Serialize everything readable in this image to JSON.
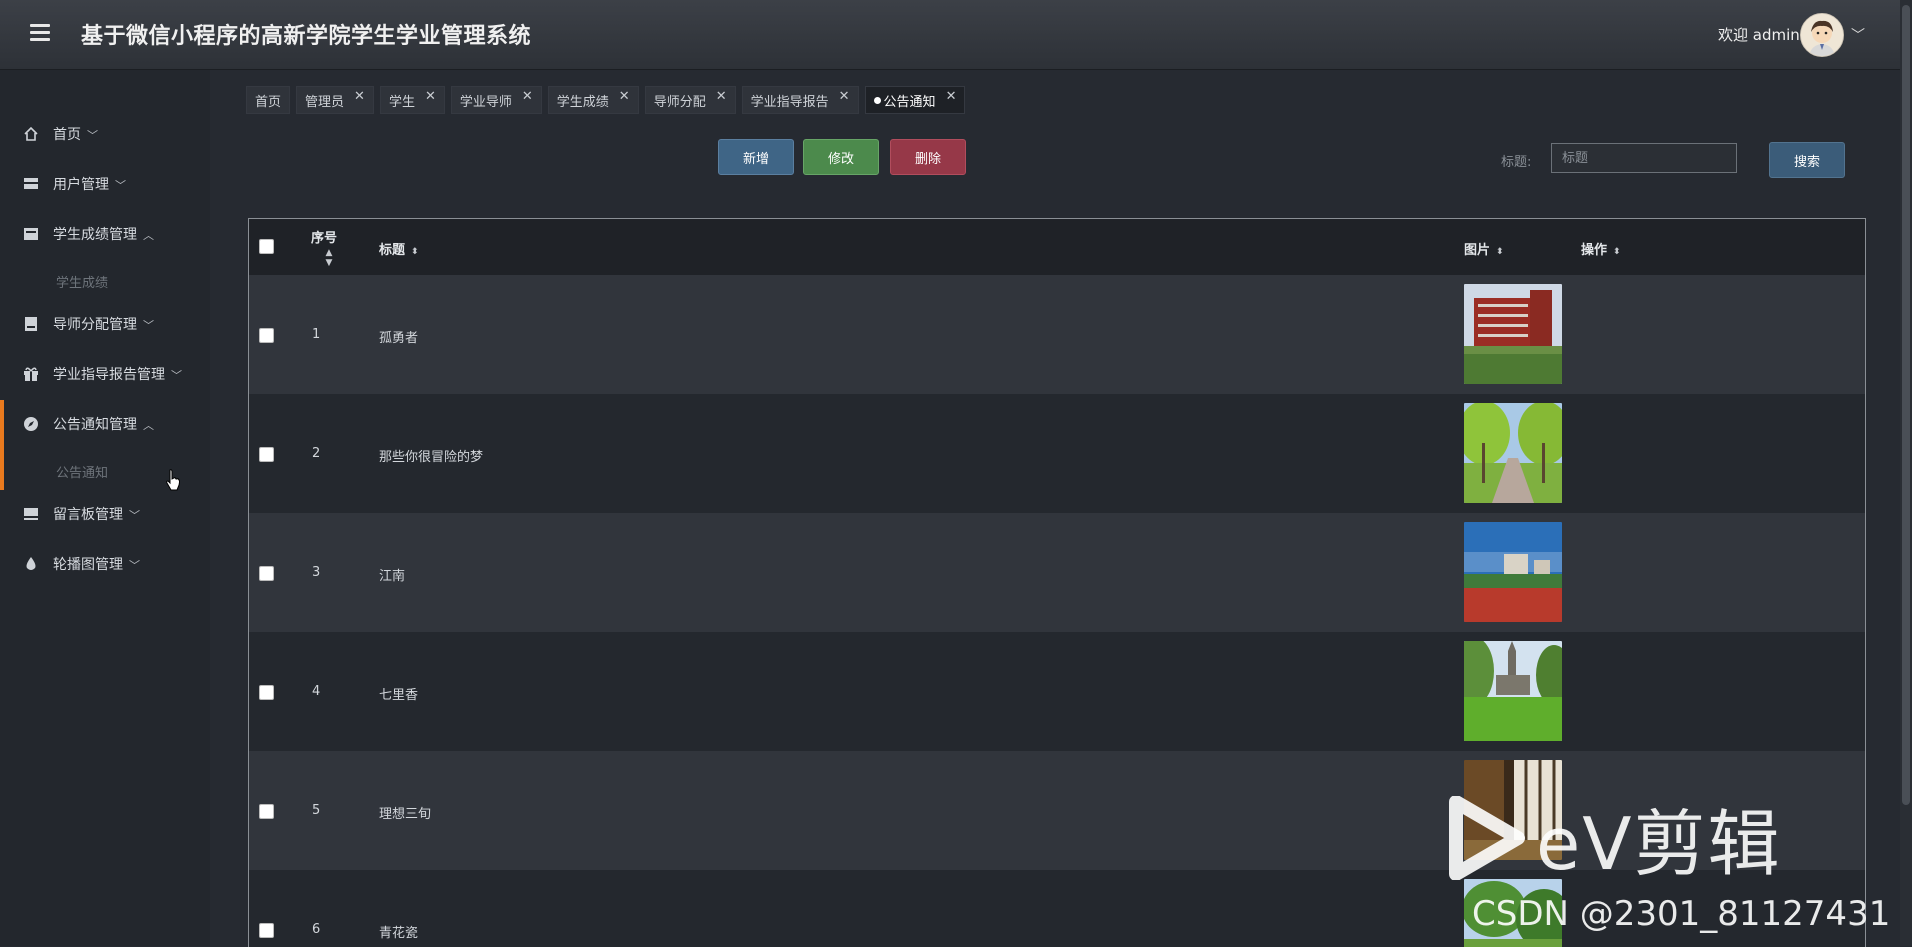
{
  "header": {
    "title": "基于微信小程序的高新学院学生学业管理系统",
    "welcome": "欢迎 admin"
  },
  "sidebar": {
    "items": [
      {
        "label": "首页",
        "icon": "home-icon",
        "chevron": "﹀"
      },
      {
        "label": "用户管理",
        "icon": "user-manage-icon",
        "chevron": "﹀"
      },
      {
        "label": "学生成绩管理",
        "icon": "grade-icon",
        "chevron": "︿",
        "sub": "学生成绩"
      },
      {
        "label": "导师分配管理",
        "icon": "tutor-icon",
        "chevron": "﹀"
      },
      {
        "label": "学业指导报告管理",
        "icon": "gift-icon",
        "chevron": "﹀"
      },
      {
        "label": "公告通知管理",
        "icon": "compass-icon",
        "chevron": "︿",
        "sub": "公告通知"
      },
      {
        "label": "留言板管理",
        "icon": "board-icon",
        "chevron": "﹀"
      },
      {
        "label": "轮播图管理",
        "icon": "drop-icon",
        "chevron": "﹀"
      }
    ]
  },
  "tabs": [
    {
      "label": "首页",
      "closable": false
    },
    {
      "label": "管理员",
      "closable": true
    },
    {
      "label": "学生",
      "closable": true
    },
    {
      "label": "学业导师",
      "closable": true
    },
    {
      "label": "学生成绩",
      "closable": true
    },
    {
      "label": "导师分配",
      "closable": true
    },
    {
      "label": "学业指导报告",
      "closable": true
    },
    {
      "label": "公告通知",
      "closable": true,
      "active": true
    }
  ],
  "toolbar": {
    "add_label": "新增",
    "edit_label": "修改",
    "delete_label": "删除",
    "search_label": "标题:",
    "search_placeholder": "标题",
    "search_button": "搜索"
  },
  "table": {
    "headers": {
      "index": "序号",
      "title": "标题",
      "image": "图片",
      "action": "操作"
    },
    "rows": [
      {
        "index": "1",
        "title": "孤勇者",
        "image": "building-photo"
      },
      {
        "index": "2",
        "title": "那些你很冒险的梦",
        "image": "tree-road-photo"
      },
      {
        "index": "3",
        "title": "江南",
        "image": "campus-track-photo"
      },
      {
        "index": "4",
        "title": "七里香",
        "image": "church-lawn-photo"
      },
      {
        "index": "5",
        "title": "理想三旬",
        "image": "hallway-photo"
      },
      {
        "index": "6",
        "title": "青花瓷",
        "image": "garden-photo"
      }
    ]
  },
  "watermark": {
    "ev": "eV剪辑",
    "csdn": "CSDN @2301_81127431"
  },
  "colors": {
    "accent": "#e97a1e",
    "add": "#3f6586",
    "edit": "#4c8a4c",
    "delete": "#963848"
  }
}
